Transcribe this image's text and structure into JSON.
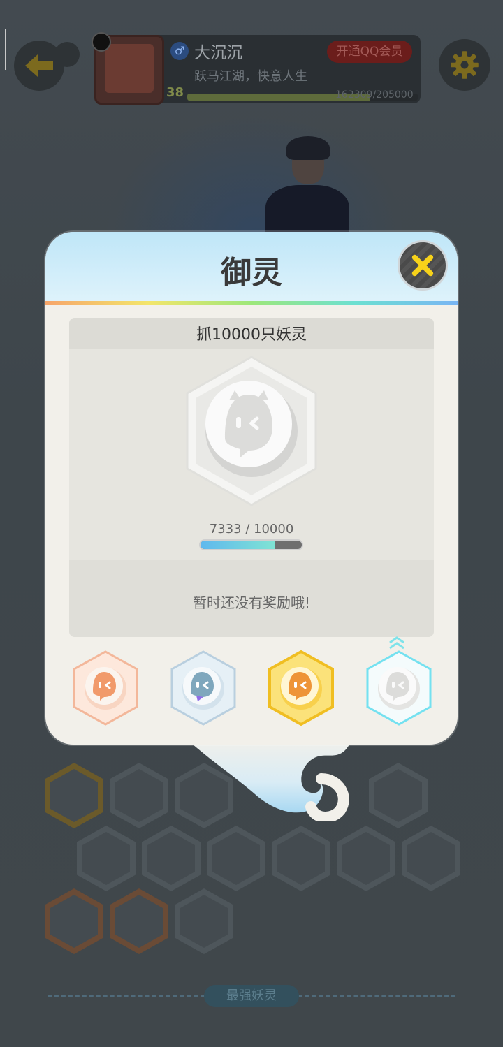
{
  "header": {
    "nickname": "大沉沉",
    "vip_label": "开通QQ会员",
    "motto": "跃马江湖，快意人生",
    "level": "38",
    "exp_text": "162309/205000",
    "exp_progress": 0.79
  },
  "icons": {
    "back": "back-arrow-icon",
    "settings": "gear-icon",
    "close": "close-icon",
    "gender": "male-icon"
  },
  "modal": {
    "title": "御灵",
    "achievement_title": "抓10000只妖灵",
    "progress_text": "7333 / 10000",
    "progress_value": 0.7333,
    "reward_text": "暂时还没有奖励哦!",
    "tiers": [
      {
        "name": "bronze",
        "color": "#f19a6b",
        "selected": false
      },
      {
        "name": "silver",
        "color": "#8fb4cc",
        "selected": false
      },
      {
        "name": "gold",
        "color": "#f4c531",
        "selected": false
      },
      {
        "name": "diamond",
        "color": "#74e1f0",
        "selected": true
      }
    ]
  },
  "footer": {
    "section_label": "最强妖灵"
  },
  "colors": {
    "accent_yellow": "#f7d21a",
    "progress_start": "#5fb8ee",
    "progress_end": "#7fe3d4"
  }
}
